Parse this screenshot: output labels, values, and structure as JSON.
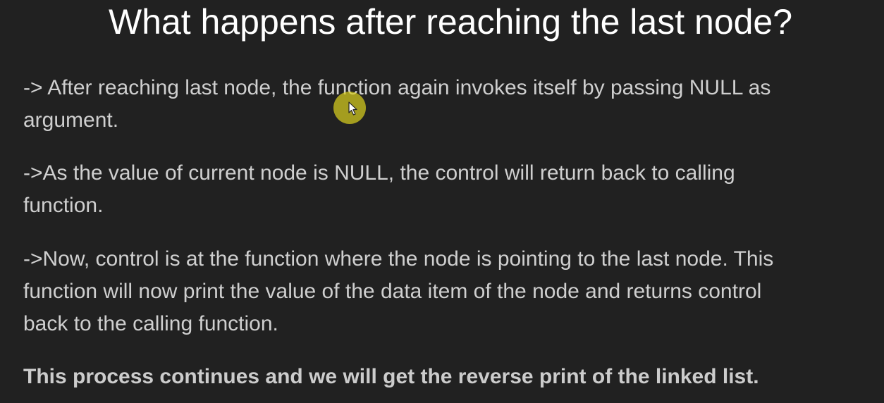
{
  "slide": {
    "title": "What happens after reaching the last node?",
    "paragraphs": [
      {
        "lines": [
          "-> After reaching last node, the function again invokes itself by passing NULL as",
          "argument."
        ]
      },
      {
        "lines": [
          "->As the value of current node is NULL, the control will return back to calling",
          "function."
        ]
      },
      {
        "lines": [
          "->Now, control is at the function where the node is pointing to the last node. This",
          "function will now print the value of the data item of the node and returns control",
          "back to the calling function."
        ]
      }
    ],
    "conclusion": "This process continues and we will get the reverse print of the linked list."
  },
  "cursor": {
    "icon": "mouse-pointer-icon",
    "highlight_color": "#d7cd1e"
  }
}
